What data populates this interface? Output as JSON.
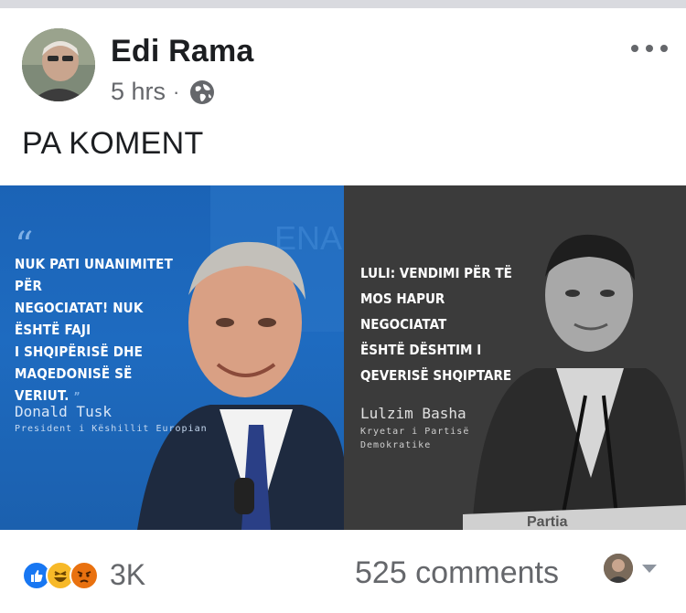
{
  "post": {
    "author": "Edi Rama",
    "time": "5 hrs",
    "separator": "·",
    "privacy_icon": "globe-icon",
    "more_icon": "more-options-icon",
    "text": "PA KOMENT"
  },
  "image": {
    "left": {
      "quote_open": "“",
      "quote_lines": [
        "NUK PATI UNANIMITET PËR",
        "NEGOCIATAT! NUK ËSHTË FAJI",
        "I SHQIPËRISË DHE",
        "MAQEDONISË SË VERIUT."
      ],
      "quote_close": "”",
      "name": "Donald Tusk",
      "role": "President i Këshillit Europian",
      "bg_color": "#1e6bc0"
    },
    "right": {
      "quote_lines": [
        "LULI: VENDIMI PËR TË",
        "MOS HAPUR NEGOCIATAT",
        "ËSHTË DËSHTIM I",
        "QEVERISË SHQIPTARE"
      ],
      "name": "Lulzim Basha",
      "role_lines": [
        "Kryetar i Partisë",
        "Demokratike"
      ],
      "podium_text": "Partia",
      "bg_color": "#3a3a3a"
    }
  },
  "footer": {
    "reactions": [
      "like-icon",
      "haha-icon",
      "angry-icon"
    ],
    "reaction_count": "3K",
    "comments": "525 comments",
    "colors": {
      "like": "#1877f2",
      "haha": "#f7b928",
      "angry": "#e9710f"
    }
  }
}
